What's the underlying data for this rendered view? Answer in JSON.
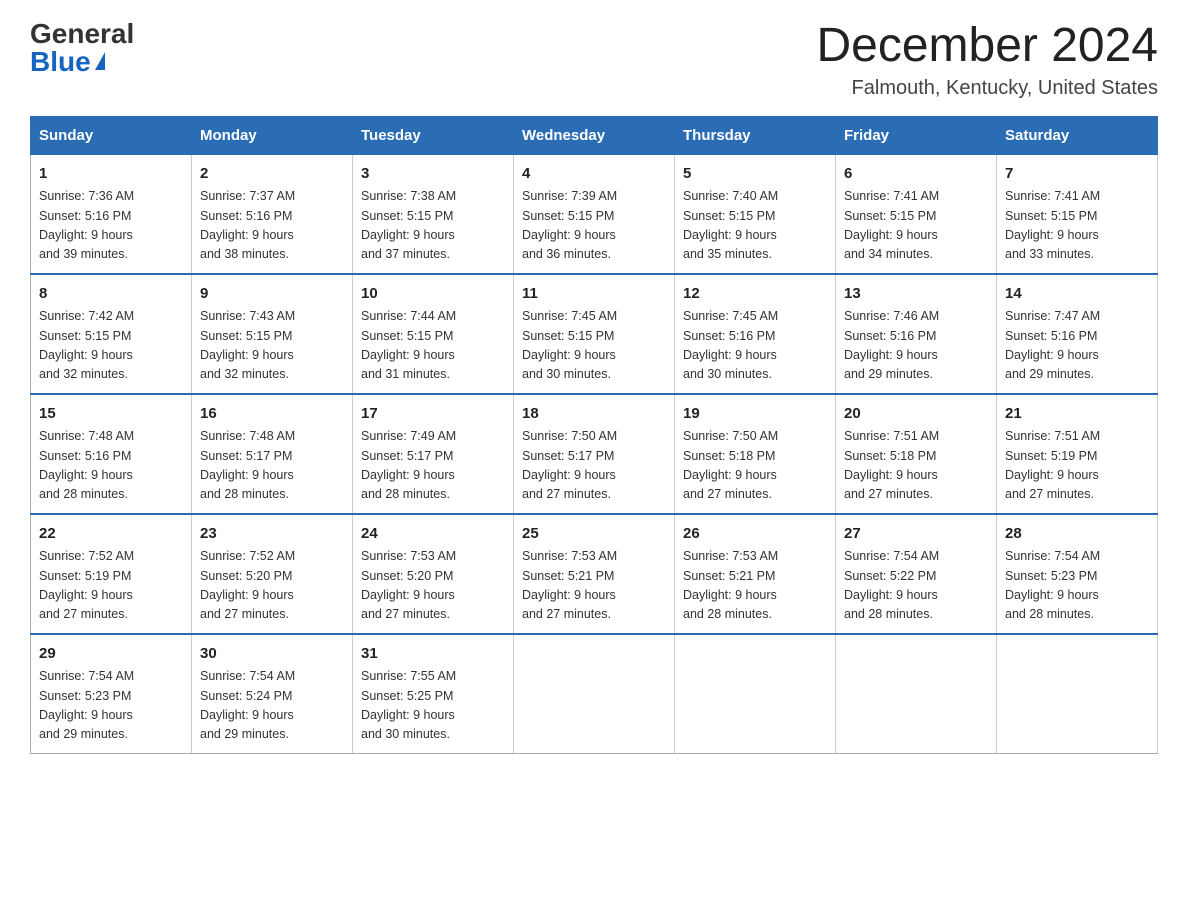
{
  "logo": {
    "general": "General",
    "blue": "Blue"
  },
  "title": "December 2024",
  "location": "Falmouth, Kentucky, United States",
  "days_of_week": [
    "Sunday",
    "Monday",
    "Tuesday",
    "Wednesday",
    "Thursday",
    "Friday",
    "Saturday"
  ],
  "weeks": [
    [
      {
        "day": "1",
        "sunrise": "7:36 AM",
        "sunset": "5:16 PM",
        "daylight": "9 hours and 39 minutes."
      },
      {
        "day": "2",
        "sunrise": "7:37 AM",
        "sunset": "5:16 PM",
        "daylight": "9 hours and 38 minutes."
      },
      {
        "day": "3",
        "sunrise": "7:38 AM",
        "sunset": "5:15 PM",
        "daylight": "9 hours and 37 minutes."
      },
      {
        "day": "4",
        "sunrise": "7:39 AM",
        "sunset": "5:15 PM",
        "daylight": "9 hours and 36 minutes."
      },
      {
        "day": "5",
        "sunrise": "7:40 AM",
        "sunset": "5:15 PM",
        "daylight": "9 hours and 35 minutes."
      },
      {
        "day": "6",
        "sunrise": "7:41 AM",
        "sunset": "5:15 PM",
        "daylight": "9 hours and 34 minutes."
      },
      {
        "day": "7",
        "sunrise": "7:41 AM",
        "sunset": "5:15 PM",
        "daylight": "9 hours and 33 minutes."
      }
    ],
    [
      {
        "day": "8",
        "sunrise": "7:42 AM",
        "sunset": "5:15 PM",
        "daylight": "9 hours and 32 minutes."
      },
      {
        "day": "9",
        "sunrise": "7:43 AM",
        "sunset": "5:15 PM",
        "daylight": "9 hours and 32 minutes."
      },
      {
        "day": "10",
        "sunrise": "7:44 AM",
        "sunset": "5:15 PM",
        "daylight": "9 hours and 31 minutes."
      },
      {
        "day": "11",
        "sunrise": "7:45 AM",
        "sunset": "5:15 PM",
        "daylight": "9 hours and 30 minutes."
      },
      {
        "day": "12",
        "sunrise": "7:45 AM",
        "sunset": "5:16 PM",
        "daylight": "9 hours and 30 minutes."
      },
      {
        "day": "13",
        "sunrise": "7:46 AM",
        "sunset": "5:16 PM",
        "daylight": "9 hours and 29 minutes."
      },
      {
        "day": "14",
        "sunrise": "7:47 AM",
        "sunset": "5:16 PM",
        "daylight": "9 hours and 29 minutes."
      }
    ],
    [
      {
        "day": "15",
        "sunrise": "7:48 AM",
        "sunset": "5:16 PM",
        "daylight": "9 hours and 28 minutes."
      },
      {
        "day": "16",
        "sunrise": "7:48 AM",
        "sunset": "5:17 PM",
        "daylight": "9 hours and 28 minutes."
      },
      {
        "day": "17",
        "sunrise": "7:49 AM",
        "sunset": "5:17 PM",
        "daylight": "9 hours and 28 minutes."
      },
      {
        "day": "18",
        "sunrise": "7:50 AM",
        "sunset": "5:17 PM",
        "daylight": "9 hours and 27 minutes."
      },
      {
        "day": "19",
        "sunrise": "7:50 AM",
        "sunset": "5:18 PM",
        "daylight": "9 hours and 27 minutes."
      },
      {
        "day": "20",
        "sunrise": "7:51 AM",
        "sunset": "5:18 PM",
        "daylight": "9 hours and 27 minutes."
      },
      {
        "day": "21",
        "sunrise": "7:51 AM",
        "sunset": "5:19 PM",
        "daylight": "9 hours and 27 minutes."
      }
    ],
    [
      {
        "day": "22",
        "sunrise": "7:52 AM",
        "sunset": "5:19 PM",
        "daylight": "9 hours and 27 minutes."
      },
      {
        "day": "23",
        "sunrise": "7:52 AM",
        "sunset": "5:20 PM",
        "daylight": "9 hours and 27 minutes."
      },
      {
        "day": "24",
        "sunrise": "7:53 AM",
        "sunset": "5:20 PM",
        "daylight": "9 hours and 27 minutes."
      },
      {
        "day": "25",
        "sunrise": "7:53 AM",
        "sunset": "5:21 PM",
        "daylight": "9 hours and 27 minutes."
      },
      {
        "day": "26",
        "sunrise": "7:53 AM",
        "sunset": "5:21 PM",
        "daylight": "9 hours and 28 minutes."
      },
      {
        "day": "27",
        "sunrise": "7:54 AM",
        "sunset": "5:22 PM",
        "daylight": "9 hours and 28 minutes."
      },
      {
        "day": "28",
        "sunrise": "7:54 AM",
        "sunset": "5:23 PM",
        "daylight": "9 hours and 28 minutes."
      }
    ],
    [
      {
        "day": "29",
        "sunrise": "7:54 AM",
        "sunset": "5:23 PM",
        "daylight": "9 hours and 29 minutes."
      },
      {
        "day": "30",
        "sunrise": "7:54 AM",
        "sunset": "5:24 PM",
        "daylight": "9 hours and 29 minutes."
      },
      {
        "day": "31",
        "sunrise": "7:55 AM",
        "sunset": "5:25 PM",
        "daylight": "9 hours and 30 minutes."
      },
      null,
      null,
      null,
      null
    ]
  ],
  "labels": {
    "sunrise": "Sunrise: ",
    "sunset": "Sunset: ",
    "daylight": "Daylight: "
  }
}
